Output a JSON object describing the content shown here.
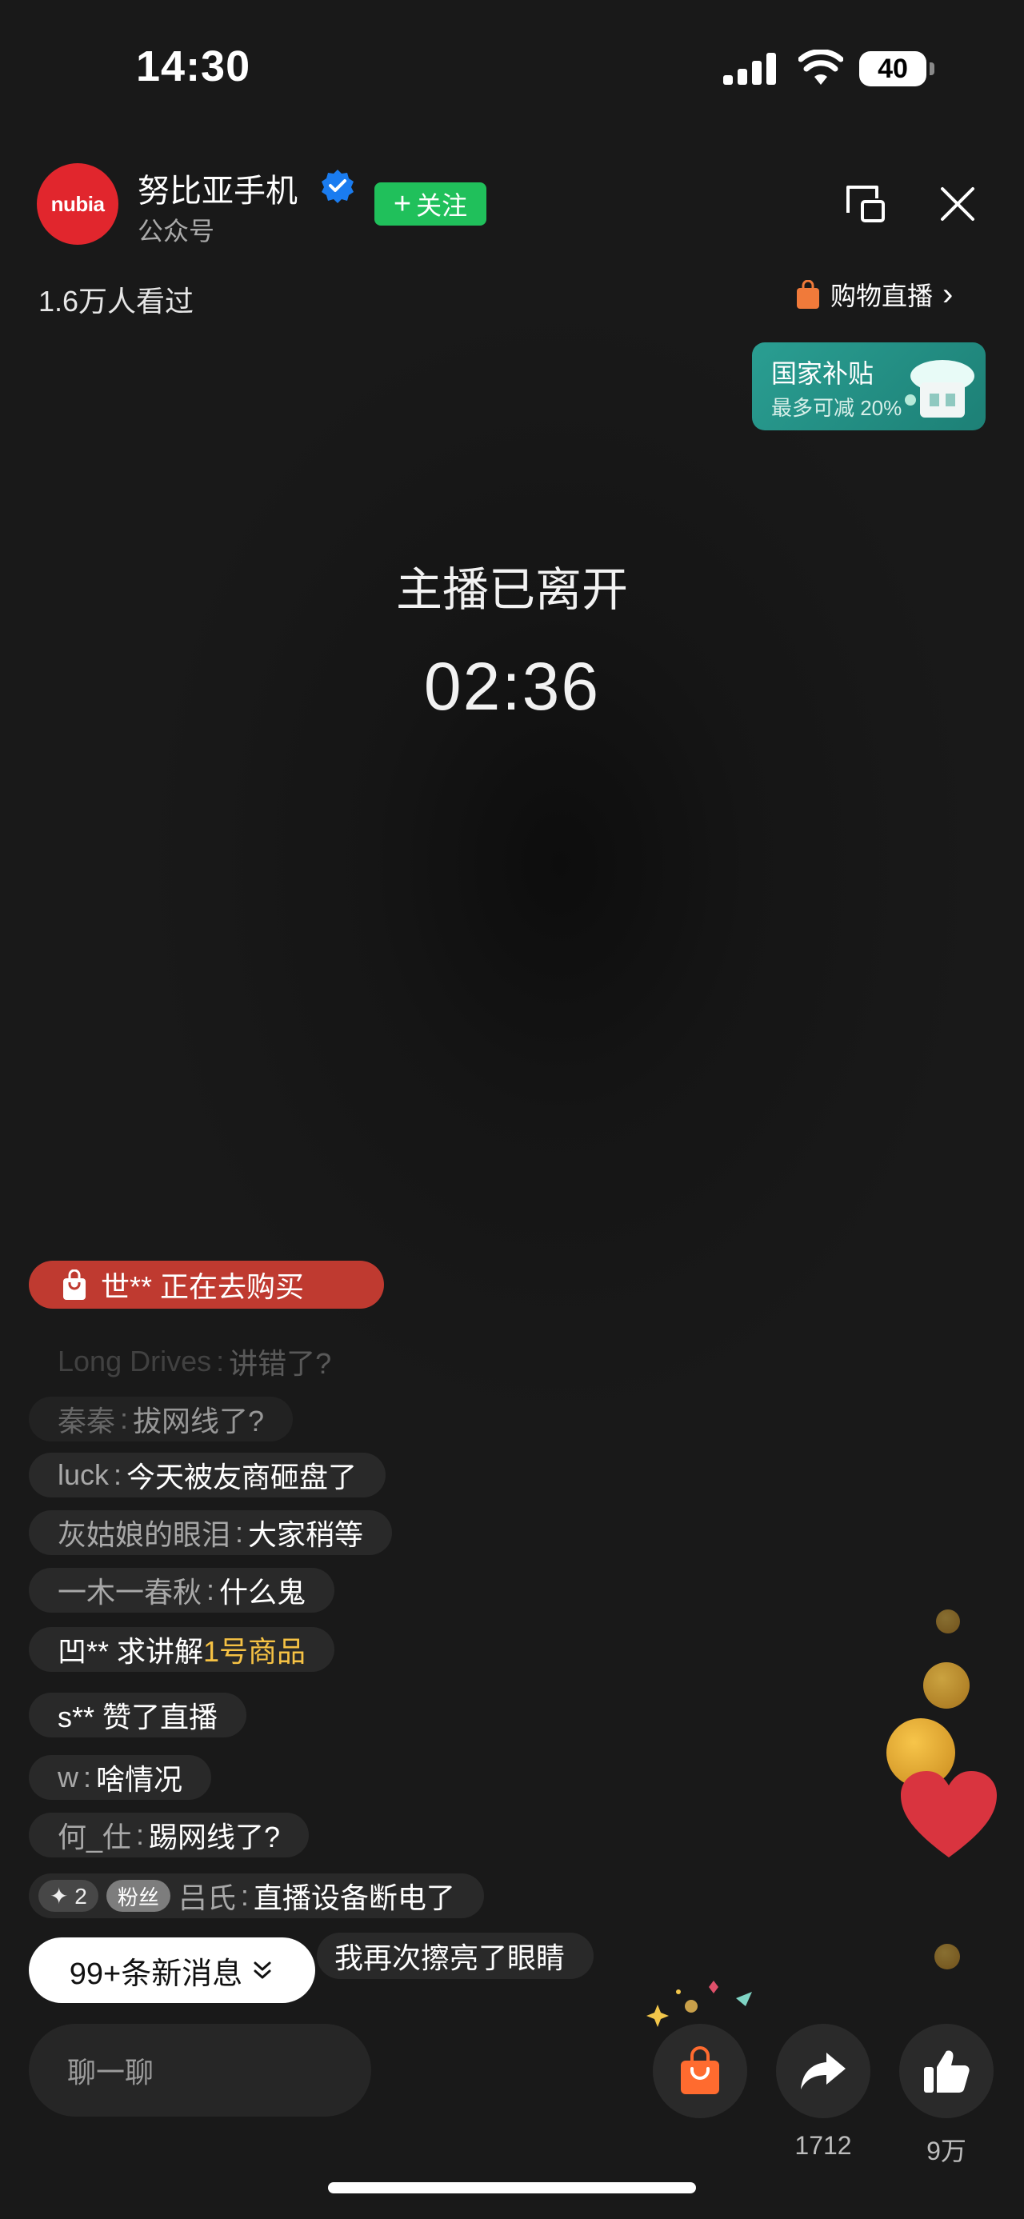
{
  "status_bar": {
    "time": "14:30",
    "battery": "40"
  },
  "header": {
    "avatar_text": "nubia",
    "account_name": "努比亚手机",
    "account_type": "公众号",
    "follow_label": "关注",
    "follow_plus": "+",
    "viewer_count": "1.6万人看过",
    "shop_live_label": "购物直播",
    "shop_live_chevron": "›"
  },
  "subsidy_banner": {
    "title": "国家补贴",
    "subtitle": "最多可减 20%"
  },
  "stage": {
    "status": "主播已离开",
    "timer": "02:36"
  },
  "purchase_banner": {
    "text": "世** 正在去购买"
  },
  "comments": [
    {
      "user": "Long Drives",
      "sep": ":",
      "text": "讲错了?"
    },
    {
      "user": "秦秦",
      "sep": ":",
      "text": "拔网线了?"
    },
    {
      "user": "luck",
      "sep": ":",
      "text": "今天被友商砸盘了"
    },
    {
      "user": "灰姑娘的眼泪",
      "sep": ":",
      "text": "大家稍等"
    },
    {
      "user": "一木一春秋",
      "sep": ":",
      "text": "什么鬼"
    },
    {
      "user": "凹** 求讲解",
      "highlight": "1号商品"
    },
    {
      "user": "s** 赞了直播"
    },
    {
      "user": "w",
      "sep": ":",
      "text": "啥情况"
    },
    {
      "user": "何_仕",
      "sep": ":",
      "text": "踢网线了?"
    },
    {
      "badge_level": "✦ 2",
      "badge_fan": "粉丝",
      "user": "吕氏",
      "sep": ":",
      "text": "直播设备断电了"
    }
  ],
  "new_messages": {
    "label": "99+条新消息",
    "chevron": "⌄"
  },
  "last_message": "我再次擦亮了眼睛",
  "bottom_bar": {
    "chat_placeholder": "聊一聊",
    "share_count": "1712",
    "like_count": "9万"
  },
  "colors": {
    "follow_green": "#20c05b",
    "brand_red": "#e1262d",
    "purchase_banner": "#bf3a30",
    "highlight": "#f6c244",
    "subsidy_teal": "#2a9e92"
  },
  "icons": [
    "signal-icon",
    "wifi-icon",
    "battery-icon",
    "verified-icon",
    "pip-icon",
    "close-icon",
    "shopping-bag-icon",
    "chevron-right-icon",
    "chevron-down-icon",
    "share-icon",
    "thumbs-up-icon",
    "heart-icon"
  ]
}
